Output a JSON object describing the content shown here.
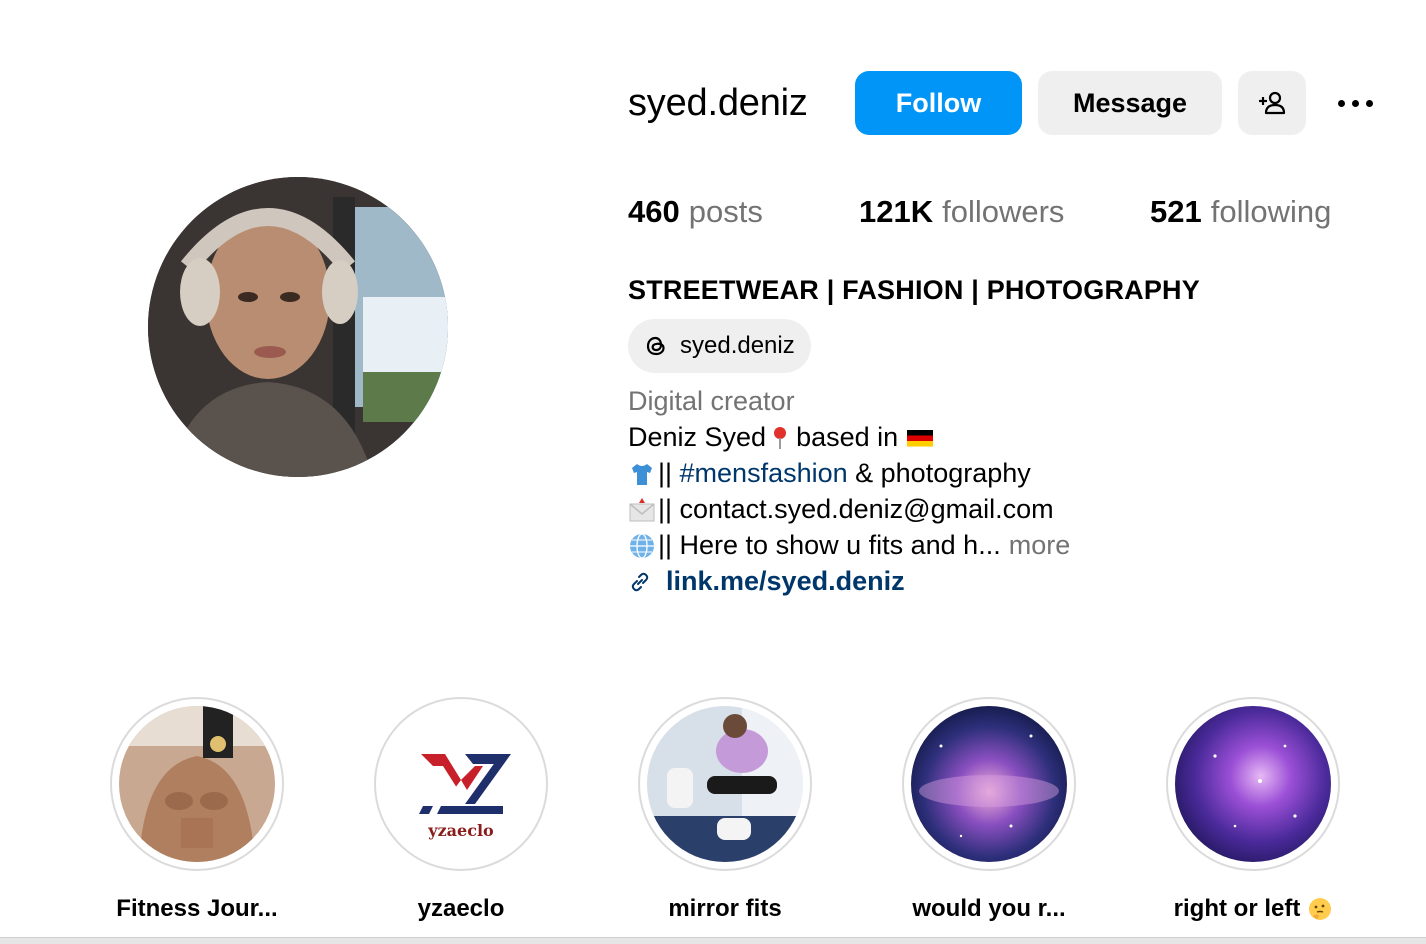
{
  "profile": {
    "username": "syed.deniz",
    "buttons": {
      "follow": "Follow",
      "message": "Message",
      "add_user_icon": "person-add-icon",
      "more_icon": "more-horizontal-icon"
    },
    "stats": {
      "posts_count": "460",
      "posts_label": "posts",
      "followers_count": "121K",
      "followers_label": "followers",
      "following_count": "521",
      "following_label": "following"
    },
    "name": "STREETWEAR | FASHION | PHOTOGRAPHY",
    "threads_handle": "syed.deniz",
    "category": "Digital creator",
    "bio": {
      "line1_text": "Deniz Syed",
      "line1_after": "based in",
      "line2_prefix": "|| ",
      "line2_hashtag": "#mensfashion",
      "line2_after": " & photography",
      "line3_text": "|| contact.syed.deniz@gmail.com",
      "line4_text": "|| Here to show u fits and h...",
      "more_label": "more"
    },
    "link": "link.me/syed.deniz"
  },
  "highlights": [
    {
      "label": "Fitness Jour..."
    },
    {
      "label": "yzaeclo",
      "logo_text": "yzaeclo"
    },
    {
      "label": "mirror fits"
    },
    {
      "label": "would you r..."
    },
    {
      "label": "right or left"
    }
  ],
  "colors": {
    "follow_blue": "#0095f6",
    "button_gray": "#efefef",
    "link_blue": "#00376b",
    "secondary_text": "#737373"
  }
}
